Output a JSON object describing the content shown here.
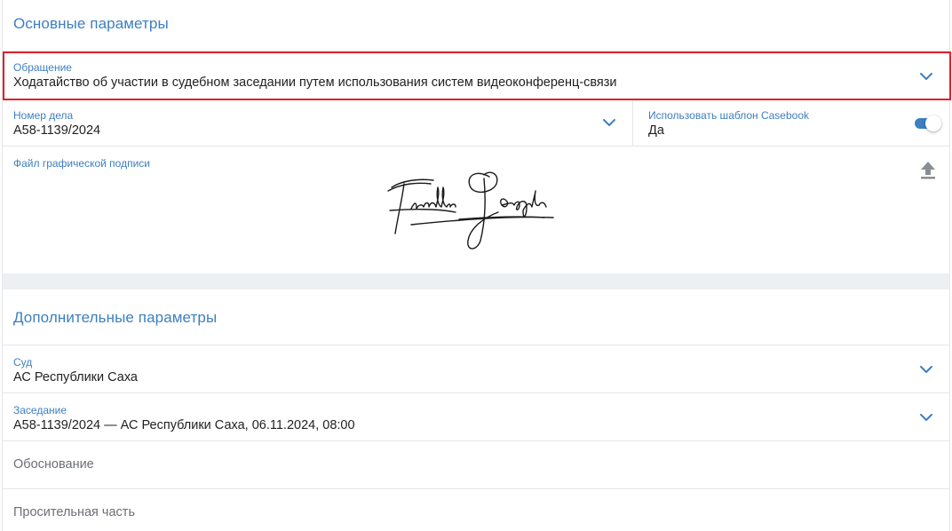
{
  "basic": {
    "title": "Основные параметры",
    "appeal": {
      "label": "Обращение",
      "value": "Ходатайство об участии в судебном заседании путем использования систем видеоконференц-связи"
    },
    "case_number": {
      "label": "Номер дела",
      "value": "А58-1139/2024"
    },
    "casebook_template": {
      "label": "Использовать шаблон Casebook",
      "value": "Да",
      "enabled": true
    },
    "signature_file": {
      "label": "Файл графической подписи"
    }
  },
  "additional": {
    "title": "Дополнительные параметры",
    "court": {
      "label": "Суд",
      "value": "АС Республики Саха"
    },
    "session": {
      "label": "Заседание",
      "value": "А58-1139/2024 — АС Республики Саха, 06.11.2024, 08:00"
    },
    "justification": {
      "placeholder": "Обоснование"
    },
    "petition_part": {
      "placeholder": "Просительная часть"
    }
  },
  "colors": {
    "accent": "#3d7fbf",
    "highlight": "#e0202a"
  },
  "icons": {
    "dropdown": "chevron-down-icon",
    "upload": "upload-icon",
    "signature": "signature-image"
  }
}
